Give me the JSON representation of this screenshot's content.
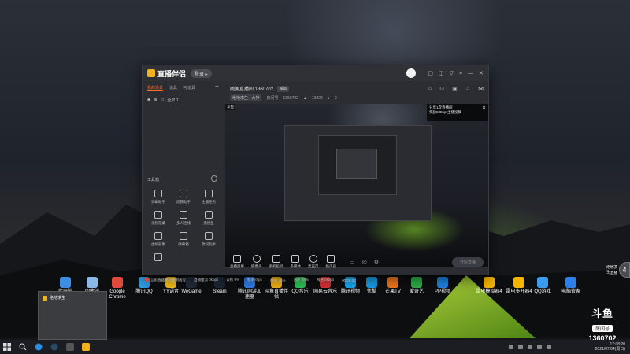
{
  "app": {
    "name": "直播伴侣",
    "login_label": "登录 ▸",
    "sidebar_tabs": [
      "我的场景",
      "道具",
      "可道具"
    ],
    "scene_label": "全屏 1",
    "tools_title": "工具箱",
    "tools": [
      "弹幕助手",
      "房管助手",
      "主播任务",
      "视频隐藏",
      "多人连线",
      "摸摸鱼",
      "虚拟形象",
      "弹幕箱",
      "歌词助手",
      "",
      "",
      ""
    ]
  },
  "room": {
    "title": "随便直播间 1360702",
    "edit_label": "编辑",
    "category": "绝地求生 · 大神",
    "room_id_label": "房间号",
    "room_id": "1360702",
    "followers": "13226",
    "viewers": "0",
    "overlay_line1": "分享1次直播间",
    "overlay_line2": "奖励50Exp  主播投稿",
    "preview_room_tag": "斗鱼"
  },
  "bottom_buttons": [
    "直播屏幕",
    "摄像头",
    "手机投屏",
    "多媒体",
    "麦克风",
    "扬声器"
  ],
  "live_button": "开始直播",
  "status": {
    "note": "斗鱼直播伴侣使用教程",
    "items": [
      "直播推流 0kbps",
      "丢帧 0%",
      "帧率 0fps",
      "CPU 46%",
      "内存 38%",
      "网速 0kbps",
      "00:00:00"
    ]
  },
  "desktop_icons": [
    {
      "label": "此电脑",
      "color": "#3c8ee0"
    },
    {
      "label": "回收站",
      "color": "#8ab8e8"
    },
    {
      "label": "Google Chrome",
      "color": "#e04a3a"
    },
    {
      "label": "腾讯QQ",
      "color": "#2e9fe6"
    },
    {
      "label": "YY语音",
      "color": "#f5c21b"
    },
    {
      "label": "WeGame",
      "color": "#222a3a"
    },
    {
      "label": "Steam",
      "color": "#1b2838"
    },
    {
      "label": "腾讯网游加速器",
      "color": "#2e7fe6"
    },
    {
      "label": "斗鱼直播伴侣",
      "color": "#f2b21d"
    },
    {
      "label": "QQ音乐",
      "color": "#2fc35a"
    },
    {
      "label": "网易云音乐",
      "color": "#d33"
    },
    {
      "label": "腾讯视频",
      "color": "#1aa8f0"
    },
    {
      "label": "优酷",
      "color": "#18a0e8"
    },
    {
      "label": "芒果TV",
      "color": "#f57a1f"
    },
    {
      "label": "爱奇艺",
      "color": "#2db24a"
    },
    {
      "label": "PP视频",
      "color": "#1e88e5"
    },
    {
      "label": "雷电模拟器4",
      "color": "#f5b400"
    },
    {
      "label": "雷电多开器4",
      "color": "#f5b400"
    },
    {
      "label": "QQ游戏",
      "color": "#3a9cf0"
    },
    {
      "label": "电脑管家",
      "color": "#2f7fe8"
    }
  ],
  "popup_title": "绝地求生",
  "watermark": {
    "logo": "斗鱼",
    "label": "房间号",
    "number": "1360702"
  },
  "side_tab": {
    "line1": "绝地求生",
    "line2": "直播",
    "count": "4"
  },
  "clock": {
    "time": "17:08:20",
    "date": "2021/07/04(周日)"
  }
}
